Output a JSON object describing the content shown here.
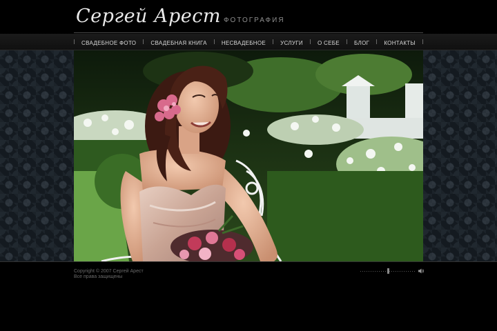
{
  "brand": {
    "name": "Сергей Арест",
    "subtitle": "ФОТОГРАФИЯ"
  },
  "nav": [
    {
      "label": "СВАДЕБНОЕ ФОТО"
    },
    {
      "label": "СВАДЕБНАЯ КНИГА"
    },
    {
      "label": "НЕСВАДЕБНОЕ"
    },
    {
      "label": "УСЛУГИ"
    },
    {
      "label": "О СЕБЕ"
    },
    {
      "label": "БЛОГ"
    },
    {
      "label": "КОНТАКТЫ"
    }
  ],
  "footer": {
    "copyright": "Copyright © 2007 Сергей Арест",
    "rights": "Все права защищены"
  },
  "volume": {
    "level": 0.5,
    "icon": "speaker-icon"
  },
  "colors": {
    "background": "#000000",
    "pattern": "#141a20",
    "nav_text": "#d8d8d8"
  }
}
